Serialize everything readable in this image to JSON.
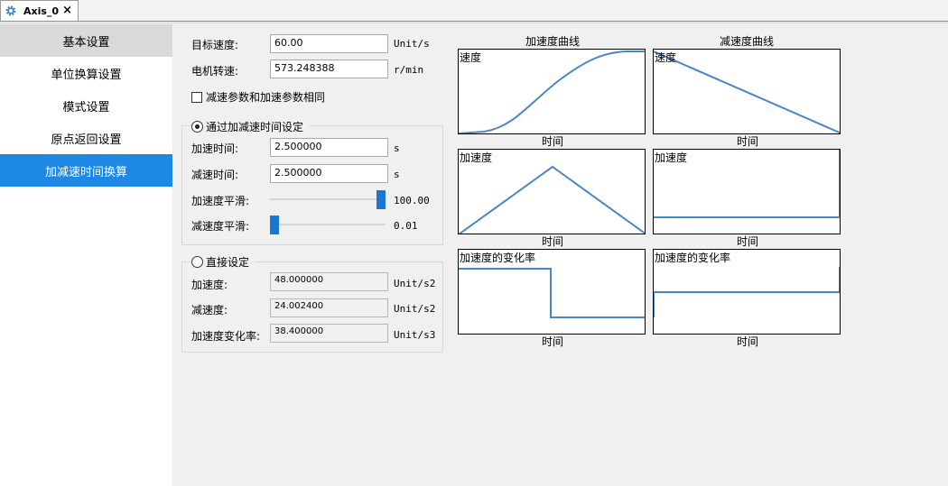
{
  "tab": {
    "title": "Axis_0",
    "close": "×",
    "icon": "gear-icon"
  },
  "sidebar": {
    "items": [
      {
        "label": "基本设置"
      },
      {
        "label": "单位换算设置"
      },
      {
        "label": "模式设置"
      },
      {
        "label": "原点返回设置"
      },
      {
        "label": "加减速时间换算"
      }
    ],
    "active_index": 4
  },
  "top": {
    "target_speed_label": "目标速度:",
    "target_speed_value": "60.00",
    "target_speed_unit": "Unit/s",
    "motor_speed_label": "电机转速:",
    "motor_speed_value": "573.248388",
    "motor_speed_unit": "r/min",
    "same_params_label": "减速参数和加速参数相同",
    "same_params_checked": false
  },
  "time_group": {
    "title": "通过加减速时间设定",
    "selected": true,
    "accel_time_label": "加速时间:",
    "accel_time_value": "2.500000",
    "accel_time_unit": "s",
    "decel_time_label": "减速时间:",
    "decel_time_value": "2.500000",
    "decel_time_unit": "s",
    "accel_smooth_label": "加速度平滑:",
    "accel_smooth_value": "100.00",
    "accel_smooth_level": 100,
    "decel_smooth_label": "减速度平滑:",
    "decel_smooth_value": "0.01",
    "decel_smooth_level": 0.01
  },
  "direct_group": {
    "title": "直接设定",
    "selected": false,
    "accel_label": "加速度:",
    "accel_value": "48.000000",
    "accel_unit": "Unit/s2",
    "decel_label": "减速度:",
    "decel_value": "24.002400",
    "decel_unit": "Unit/s2",
    "jerk_label": "加速度变化率:",
    "jerk_value": "38.400000",
    "jerk_unit": "Unit/s3"
  },
  "charts": {
    "accel_title": "加速度曲线",
    "decel_title": "减速度曲线",
    "speed_label": "速度",
    "accel_label": "加速度",
    "jerk_label": "加速度的变化率",
    "x_label": "时间",
    "line_color": "#4a86c5"
  }
}
